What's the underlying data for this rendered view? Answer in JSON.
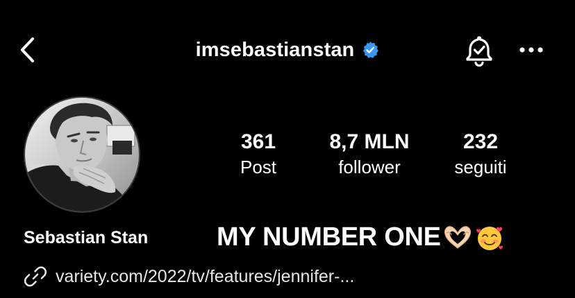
{
  "header": {
    "username": "imsebastianstan",
    "verified": true,
    "accent_verified_color": "#3797f0",
    "icons": [
      "chevron-left-icon",
      "verified-badge-icon",
      "bell-check-icon",
      "more-horizontal-icon"
    ]
  },
  "profile": {
    "display_name": "Sebastian Stan",
    "bio": "MY NUMBER ONE",
    "bio_emojis": [
      "heart-hands-emoji",
      "smiling-face-with-hearts-emoji"
    ],
    "link_text": "variety.com/2022/tv/features/jennifer-...",
    "avatar_icon": "profile-photo"
  },
  "stats": [
    {
      "value": "361",
      "label": "Post"
    },
    {
      "value": "8,7 MLN",
      "label": "follower"
    },
    {
      "value": "232",
      "label": "seguiti"
    }
  ],
  "colors": {
    "background": "#000000",
    "text": "#ffffff"
  }
}
